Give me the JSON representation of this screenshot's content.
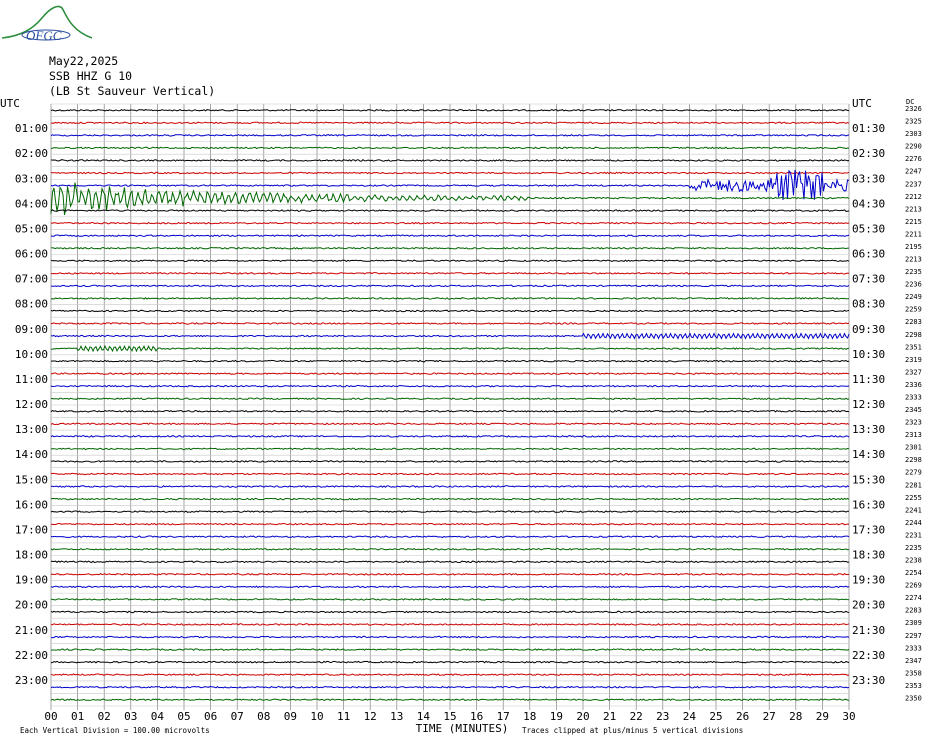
{
  "logo": {
    "name": "OFGC"
  },
  "header": {
    "date": "May22,2025",
    "station": "SSB HHZ G 10",
    "location": "(LB St Sauveur Vertical)"
  },
  "labels": {
    "utc_left": "UTC",
    "utc_right": "UTC",
    "dc": "DC",
    "xlabel": "TIME (MINUTES)",
    "vertical_division": "Each Vertical Division =  100.00 microvolts",
    "clip_note": "Traces clipped at plus/minus 5 vertical divisions"
  },
  "colors": {
    "trace_cycle": [
      "#000000",
      "#cc0000",
      "#0000cc",
      "#006600"
    ],
    "grid": "#808080",
    "background": "#ffffff"
  },
  "chart_data": {
    "type": "line",
    "title": "SSB HHZ G 10 (LB St Sauveur Vertical)",
    "date": "May22,2025",
    "xlabel": "TIME (MINUTES)",
    "x_ticks": [
      "00",
      "01",
      "02",
      "03",
      "04",
      "05",
      "06",
      "07",
      "08",
      "09",
      "10",
      "11",
      "12",
      "13",
      "14",
      "15",
      "16",
      "17",
      "18",
      "19",
      "20",
      "21",
      "22",
      "23",
      "24",
      "25",
      "26",
      "27",
      "28",
      "29",
      "30"
    ],
    "xlim": [
      0,
      30
    ],
    "grid": true,
    "left_time_labels": [
      "UTC",
      "01:00",
      "02:00",
      "03:00",
      "04:00",
      "05:00",
      "06:00",
      "07:00",
      "08:00",
      "09:00",
      "10:00",
      "11:00",
      "12:00",
      "13:00",
      "14:00",
      "15:00",
      "16:00",
      "17:00",
      "18:00",
      "19:00",
      "20:00",
      "21:00",
      "22:00",
      "23:00"
    ],
    "right_time_labels": [
      "UTC",
      "01:30",
      "02:30",
      "03:30",
      "04:30",
      "05:30",
      "06:30",
      "07:30",
      "08:30",
      "09:30",
      "10:30",
      "11:30",
      "12:30",
      "13:30",
      "14:30",
      "15:30",
      "16:30",
      "17:30",
      "18:30",
      "19:30",
      "20:30",
      "21:30",
      "22:30",
      "23:30"
    ],
    "dc_offsets": [
      2326,
      2325,
      2303,
      2290,
      2276,
      2247,
      2237,
      2212,
      2213,
      2215,
      2211,
      2195,
      2213,
      2235,
      2236,
      2249,
      2259,
      2283,
      2298,
      2351,
      2319,
      2327,
      2336,
      2333,
      2345,
      2323,
      2313,
      2301,
      2298,
      2279,
      2281,
      2255,
      2241,
      2244,
      2231,
      2235,
      2238,
      2254,
      2269,
      2274,
      2283,
      2309,
      2297,
      2333,
      2347,
      2358,
      2353,
      2350
    ],
    "traces_per_hour": 2,
    "minutes_per_trace": 30,
    "events": [
      {
        "trace": 7,
        "start_min": 0,
        "end_min": 18,
        "note": "large decaying oscillation"
      },
      {
        "trace": 6,
        "start_min": 24,
        "end_min": 30,
        "note": "burst"
      },
      {
        "trace": 18,
        "start_min": 20,
        "end_min": 30,
        "note": "small oscillation"
      },
      {
        "trace": 19,
        "start_min": 1,
        "end_min": 4,
        "note": "small oscillation"
      }
    ]
  }
}
